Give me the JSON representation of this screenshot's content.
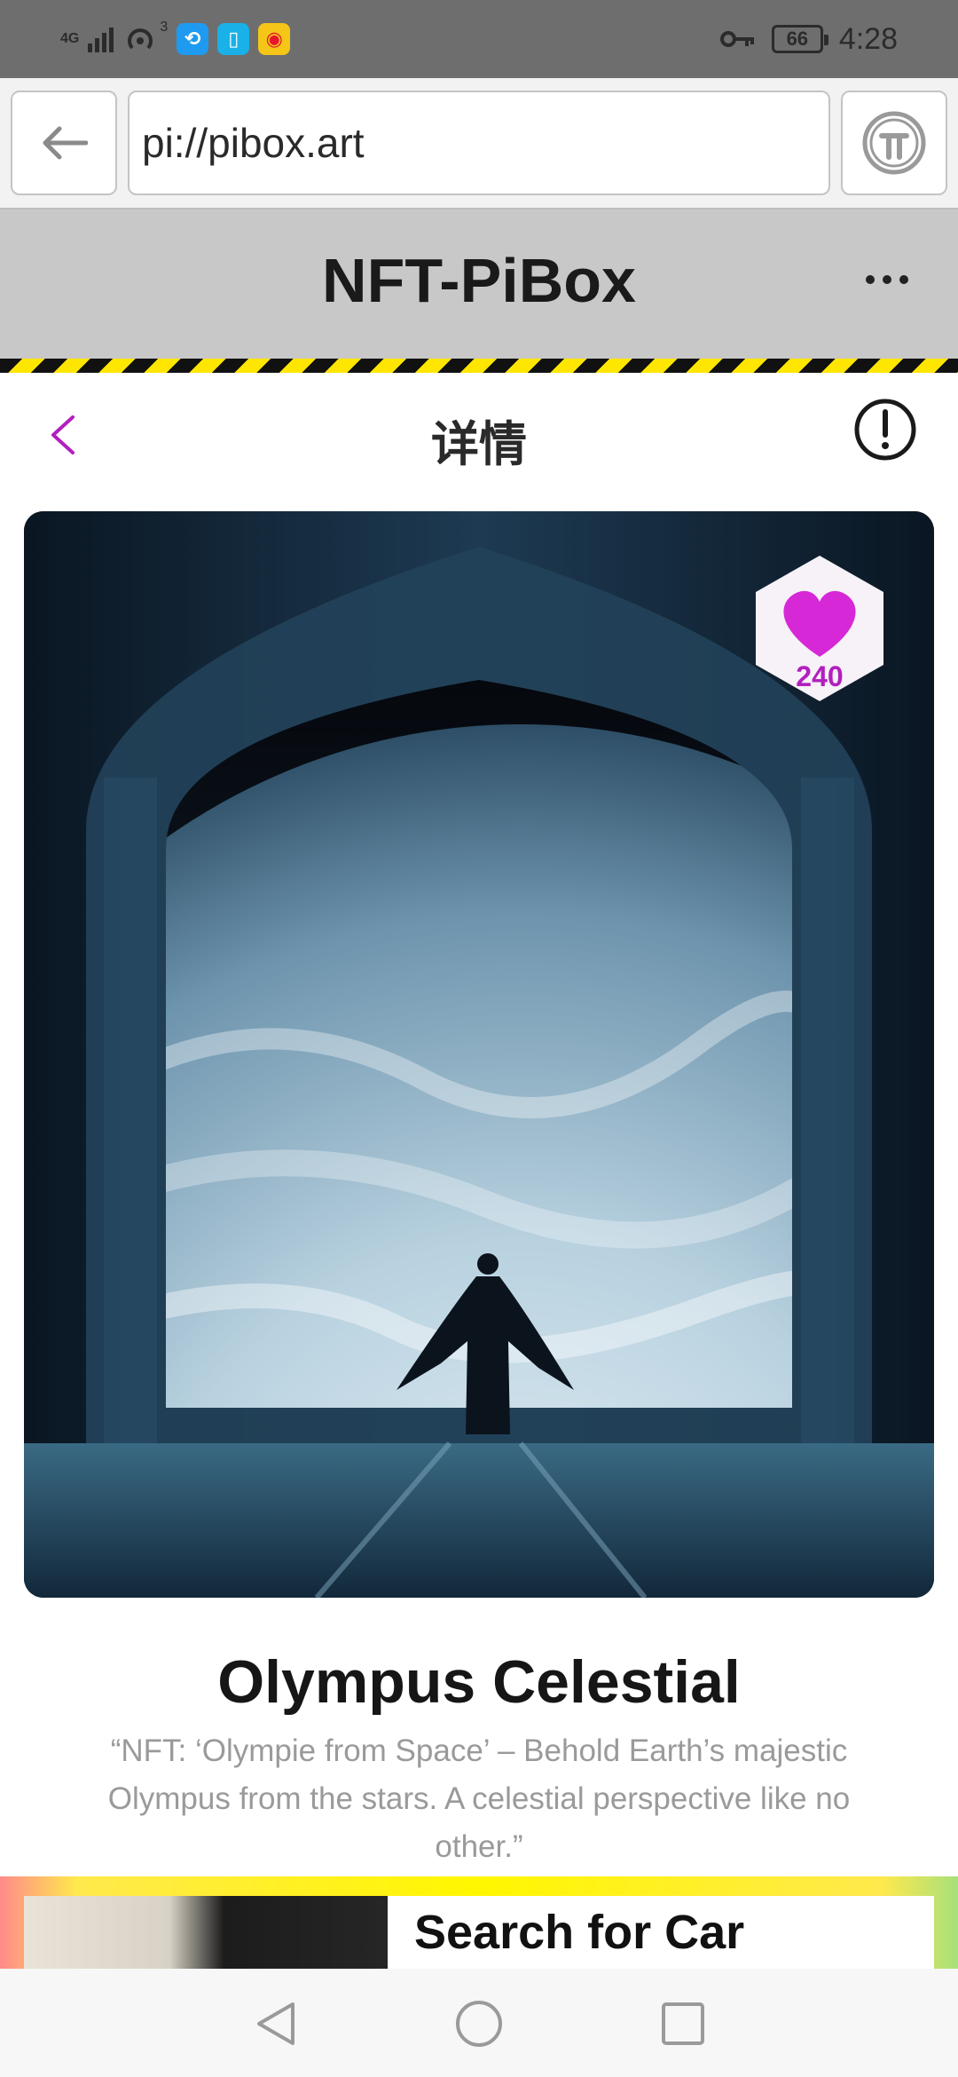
{
  "status_bar": {
    "network_label": "4G",
    "sim_index": "3",
    "battery": "66",
    "time": "4:28",
    "icons": [
      "signal-icon",
      "hotspot-icon",
      "app-icon-blue",
      "app-icon-book",
      "weibo-icon",
      "key-icon",
      "battery-icon"
    ]
  },
  "browser": {
    "url": "pi://pibox.art",
    "back_icon": "arrow-left-icon",
    "pi_icon": "pi-logo-icon"
  },
  "app_header": {
    "title": "NFT-PiBox",
    "menu_icon": "more-icon"
  },
  "detail": {
    "title": "详情",
    "back_icon": "chevron-left-icon",
    "info_icon": "info-icon"
  },
  "nft": {
    "likes": "240",
    "title": "Olympus Celestial",
    "description": "“NFT: ‘Olympie from Space’ – Behold Earth’s majestic Olympus from the stars. A celestial perspective like no other.”"
  },
  "ad": {
    "text": "Search for Car"
  },
  "colors": {
    "accent": "#b21fbf",
    "header_bg": "#c8c8c8",
    "hazard_yellow": "#ffe600"
  }
}
